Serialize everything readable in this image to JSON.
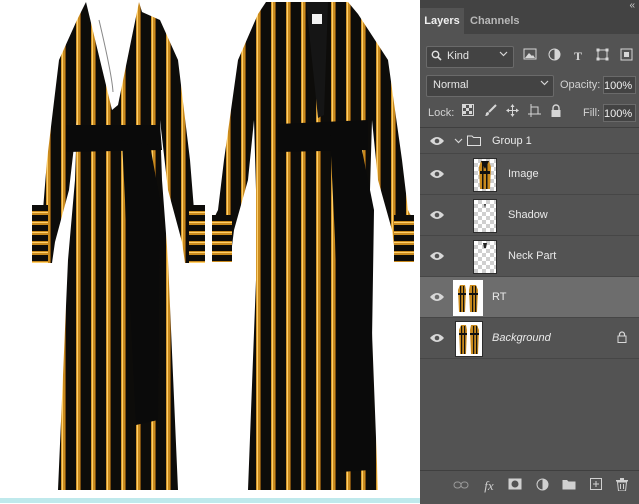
{
  "panel": {
    "tabs": [
      {
        "label": "Layers",
        "active": true
      },
      {
        "label": "Channels",
        "active": false
      }
    ],
    "collapse_glyph": "«",
    "filter": {
      "kind_label": "Kind",
      "icons": [
        "image-filter-icon",
        "adjustment-filter-icon",
        "type-filter-icon",
        "shape-filter-icon",
        "smart-object-filter-icon"
      ]
    },
    "blend_mode": "Normal",
    "opacity_label": "Opacity:",
    "opacity_value": "100%",
    "lock_label": "Lock:",
    "lock_icons": [
      "lock-transparent-icon",
      "lock-paint-icon",
      "lock-move-icon",
      "lock-artboard-icon",
      "lock-all-icon"
    ],
    "fill_label": "Fill:",
    "fill_value": "100%",
    "layers": [
      {
        "name": "Group 1",
        "type": "group",
        "expanded": true,
        "visible": true
      },
      {
        "name": "Image",
        "type": "layer",
        "visible": true,
        "indent": true
      },
      {
        "name": "Shadow",
        "type": "layer",
        "visible": true,
        "indent": true
      },
      {
        "name": "Neck Part",
        "type": "layer",
        "visible": true,
        "indent": true
      },
      {
        "name": "RT",
        "type": "layer",
        "visible": true,
        "selected": true
      },
      {
        "name": "Background",
        "type": "background",
        "visible": true,
        "locked": true
      }
    ],
    "bottom_icons": [
      "link-layers-icon",
      "fx-icon",
      "layer-mask-icon",
      "adjustment-layer-icon",
      "new-group-icon",
      "new-layer-icon",
      "delete-layer-icon"
    ],
    "fx_label": "fx"
  },
  "colors": {
    "panel_bg": "#535353",
    "selected_row": "#6d6d6d",
    "dress_black": "#0c0c0c",
    "dress_gold": "#c98a1d"
  }
}
